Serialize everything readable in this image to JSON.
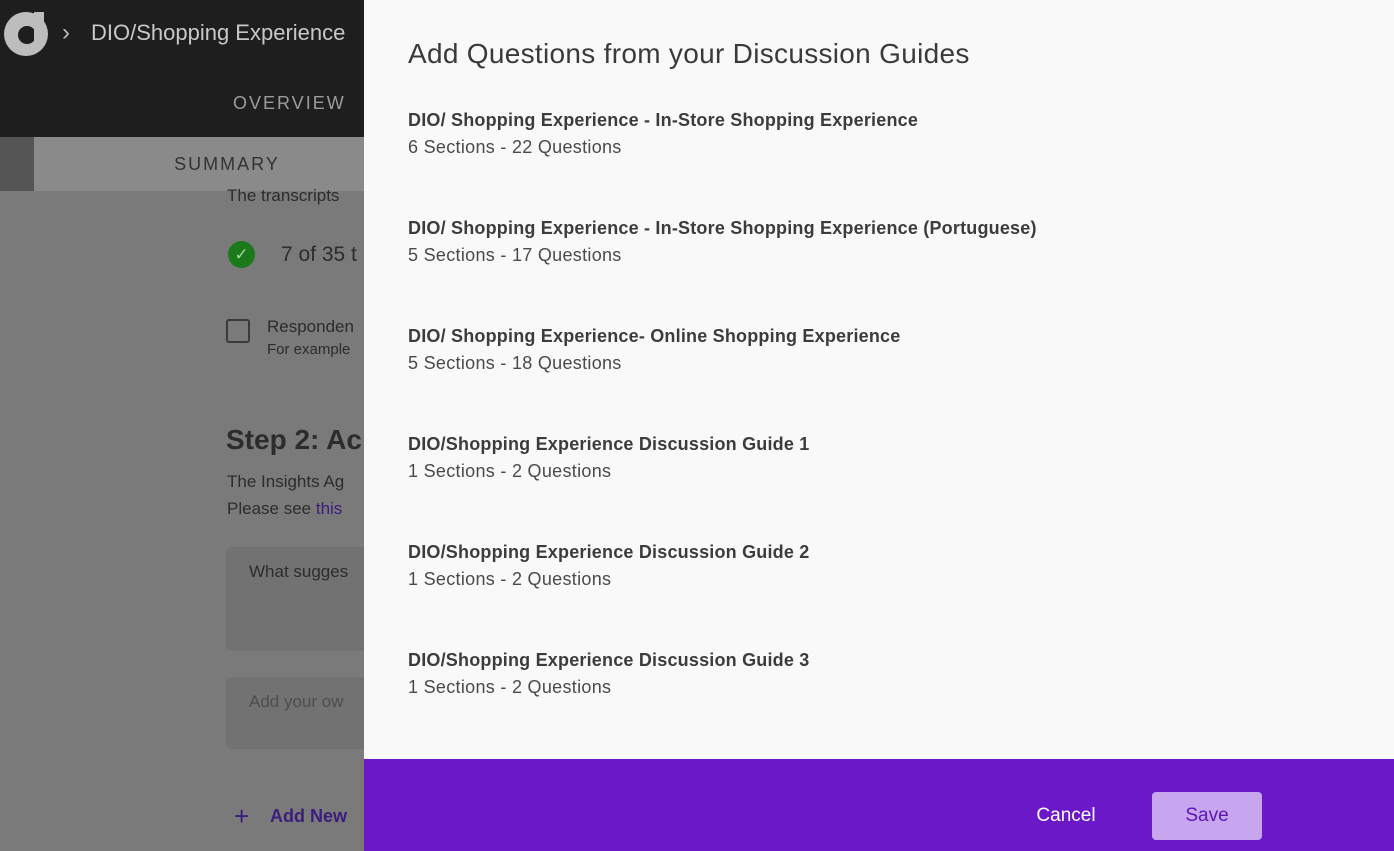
{
  "app": {
    "breadcrumb": "DIO/Shopping Experience",
    "tabs": {
      "overview": "OVERVIEW",
      "summary": "SUMMARY"
    }
  },
  "background": {
    "transcripts_text": "The transcripts",
    "progress_text": "7 of 35 t",
    "respondent_label": "Responden",
    "respondent_hint": "For example",
    "step2_heading": "Step 2: Ac",
    "insights_text": "The Insights Ag",
    "please_see": "Please see ",
    "please_see_link": "this",
    "suggestion_card": "What sugges",
    "own_placeholder": "Add your ow",
    "add_new": "Add New"
  },
  "modal": {
    "title": "Add Questions from your Discussion Guides",
    "guides": [
      {
        "title": "DIO/ Shopping Experience - In-Store Shopping Experience",
        "meta": "6 Sections - 22 Questions"
      },
      {
        "title": "DIO/ Shopping Experience - In-Store Shopping Experience (Portuguese)",
        "meta": "5 Sections - 17 Questions"
      },
      {
        "title": "DIO/ Shopping Experience- Online Shopping Experience",
        "meta": "5 Sections - 18 Questions"
      },
      {
        "title": "DIO/Shopping Experience Discussion Guide 1",
        "meta": "1 Sections - 2 Questions"
      },
      {
        "title": "DIO/Shopping Experience Discussion Guide 2",
        "meta": "1 Sections - 2 Questions"
      },
      {
        "title": "DIO/Shopping Experience Discussion Guide 3",
        "meta": "1 Sections - 2 Questions"
      }
    ],
    "cancel_label": "Cancel",
    "save_label": "Save"
  },
  "colors": {
    "accent": "#6b18c9",
    "save_button": "#c7a5ef"
  },
  "icons": [
    "logo-icon",
    "chevron-right-icon",
    "check-circle-icon",
    "checkbox-icon",
    "plus-icon"
  ]
}
